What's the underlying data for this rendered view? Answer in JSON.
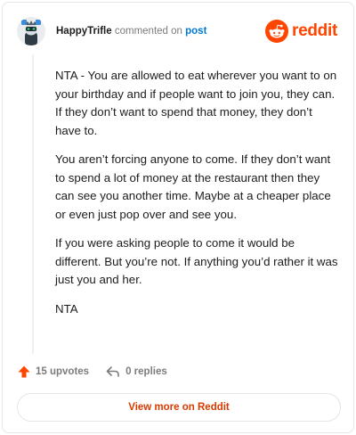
{
  "header": {
    "username": "HappyTrifle",
    "action_text": "commented on",
    "post_link": "post",
    "brand": "reddit"
  },
  "comment": {
    "paragraphs": [
      "NTA - You are allowed to eat wherever you want to on your birthday and if people want to join you, they can. If they don’t want to spend that money, they don’t have to.",
      "You aren’t forcing anyone to come. If they don’t want to spend a lot of money at the restaurant then they can see you another time. Maybe at a cheaper place or even just pop over and see you.",
      "If you were asking people to come it would be different. But you’re not. If anything you’d rather it was just you and her.",
      "NTA"
    ]
  },
  "actions": {
    "upvotes_label": "15 upvotes",
    "replies_label": "0 replies"
  },
  "footer": {
    "view_more_label": "View more on Reddit"
  },
  "colors": {
    "accent": "#ff4500",
    "upvote": "#ff4500",
    "link": "#0079d3",
    "view_more_text": "#d93a00"
  },
  "icons": {
    "avatar": "avatar-icon",
    "brand": "reddit-snoo-icon",
    "upvote": "upvote-arrow-icon",
    "reply": "reply-arrow-icon"
  }
}
